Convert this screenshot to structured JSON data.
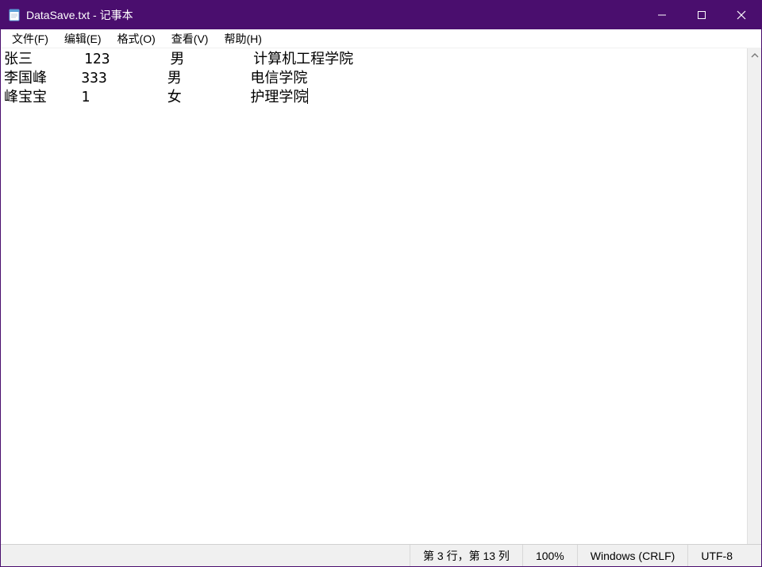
{
  "titlebar": {
    "title": "DataSave.txt - 记事本"
  },
  "menu": {
    "file": "文件(F)",
    "edit": "编辑(E)",
    "format": "格式(O)",
    "view": "查看(V)",
    "help": "帮助(H)"
  },
  "content_lines": [
    "张三      123       男        计算机工程学院",
    "李国峰    333       男        电信学院",
    "峰宝宝    1         女        护理学院"
  ],
  "statusbar": {
    "position": "第 3 行，第 13 列",
    "zoom": "100%",
    "line_ending": "Windows (CRLF)",
    "encoding": "UTF-8"
  }
}
